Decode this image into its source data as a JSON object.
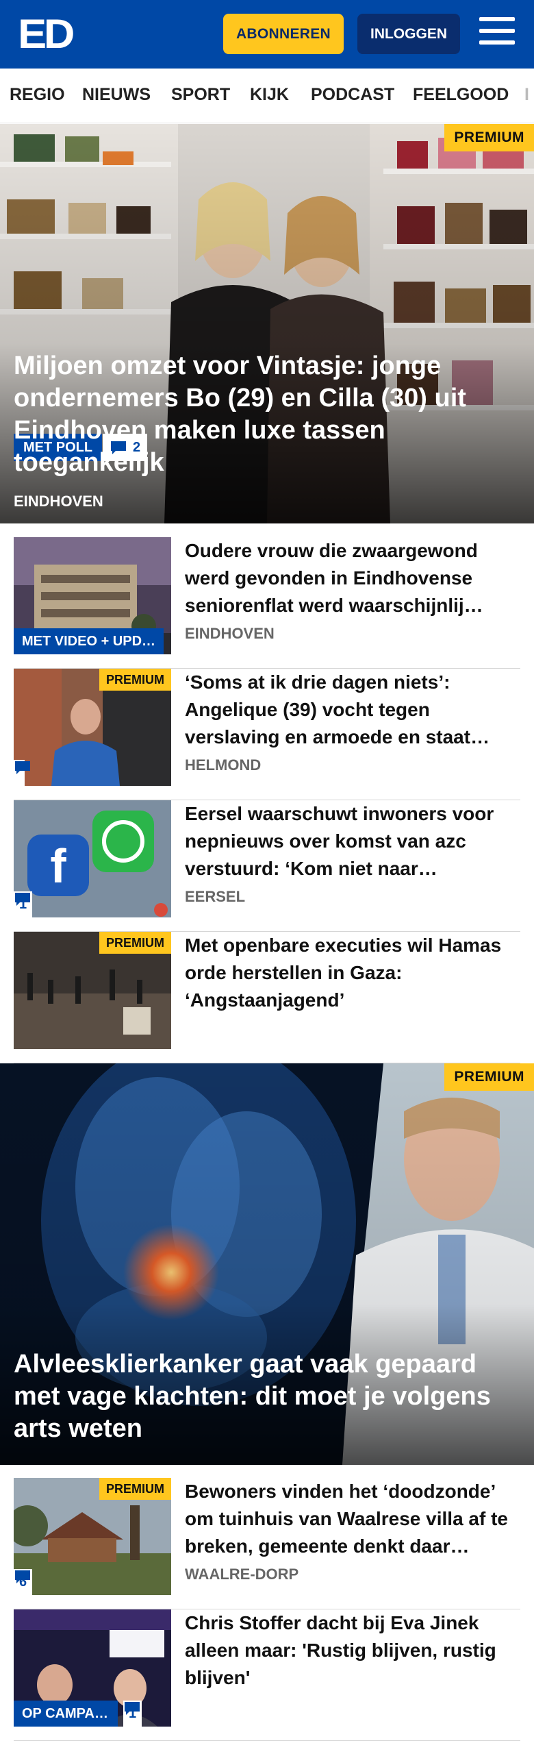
{
  "header": {
    "logo": "ED",
    "subscribe_label": "ABONNEREN",
    "login_label": "INLOGGEN"
  },
  "nav": [
    "REGIO",
    "NIEUWS",
    "SPORT",
    "KIJK",
    "PODCAST",
    "FEELGOOD",
    "I"
  ],
  "hero1": {
    "premium": "PREMIUM",
    "poll_label": "MET POLL",
    "comments": "2",
    "title": "Miljoen omzet voor Vintasje: jonge ondernemers Bo (29) en Cilla (30) uit Eindhoven maken luxe tassen toegankelijk",
    "region": "EINDHOVEN"
  },
  "list1": [
    {
      "title": "Oudere vrouw die zwaargewond werd gevonden in Eindhovense seniorenflat werd waarschijnlij…",
      "region": "EINDHOVEN",
      "badge": "MET VIDEO + UPD…"
    },
    {
      "title": "‘Soms at ik drie dagen niets’: Angelique (39) vocht tegen verslaving en armoede en staat…",
      "region": "HELMOND",
      "premium": "PREMIUM",
      "comments": ""
    },
    {
      "title": "Eersel waarschuwt inwoners voor nepnieuws over komst van azc verstuurd: ‘Kom niet naar…",
      "region": "EERSEL",
      "comments": "1"
    },
    {
      "title": "Met openbare executies wil Hamas orde herstellen in Gaza: ‘Angstaanjagend’",
      "premium": "PREMIUM"
    }
  ],
  "hero2": {
    "premium": "PREMIUM",
    "title": "Alvleesklierkanker gaat vaak gepaard met vage klachten: dit moet je volgens arts weten"
  },
  "list2": [
    {
      "title": "Bewoners vinden het ‘doodzonde’ om tuinhuis van Waalrese villa af te breken, gemeente denkt daar…",
      "region": "WAALRE-DORP",
      "premium": "PREMIUM",
      "comments": "6"
    },
    {
      "title": "Chris Stoffer dacht bij Eva Jinek alleen maar: 'Rustig blijven, rustig blijven'",
      "badge": "OP CAMPA…",
      "comments": "1"
    }
  ],
  "colors": {
    "brand_blue": "#0048a6",
    "premium_yellow": "#ffc61e",
    "login_navy": "#0a2d6e"
  },
  "icons": [
    "menu-icon",
    "comment-icon"
  ]
}
